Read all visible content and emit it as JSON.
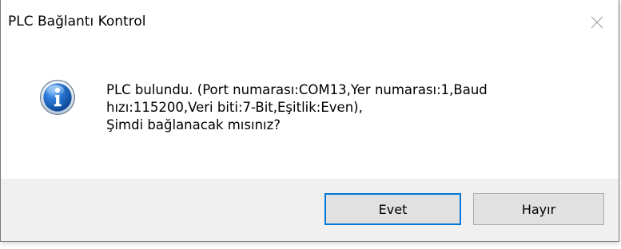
{
  "dialog": {
    "title": "PLC Bağlantı Kontrol",
    "close_icon": "close-icon",
    "message_icon": "info-icon",
    "message_lines": [
      "PLC bulundu. (Port numarası:COM13,Yer numarası:1,Baud",
      "hızı:115200,Veri biti:7-Bit,Eşitlik:Even),",
      " Şimdi bağlanacak mısınız?"
    ],
    "buttons": {
      "yes": "Evet",
      "no": "Hayır"
    },
    "colors": {
      "focus_border": "#0078d7",
      "footer_background": "#f0f0f0",
      "button_background": "#e1e1e1",
      "button_border": "#adadad",
      "info_icon": "#1f62b6"
    }
  }
}
